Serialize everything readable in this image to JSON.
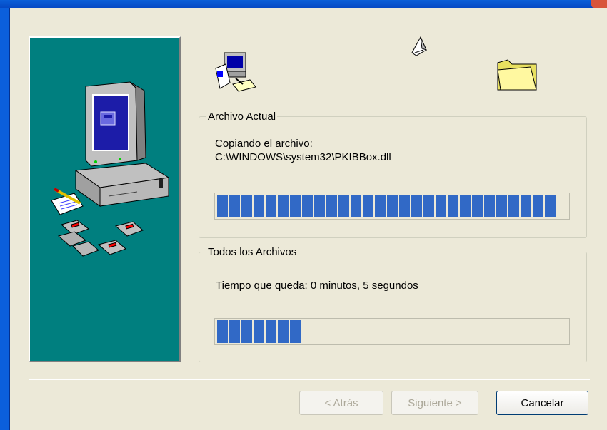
{
  "dialog": {
    "current_file_group": {
      "title": "Archivo Actual",
      "status_label": "Copiando el archivo:",
      "file_path": "C:\\WINDOWS\\system32\\PKIBBox.dll",
      "progress_fraction": 1.0
    },
    "all_files_group": {
      "title": "Todos los Archivos",
      "time_remaining": "Tiempo que queda: 0 minutos, 5 segundos",
      "progress_fraction": 0.25
    },
    "buttons": {
      "back": "< Atrás",
      "next": "Siguiente >",
      "cancel": "Cancelar"
    }
  },
  "icons": {
    "side_art": "computer-with-disks-icon",
    "setup": "setup-computer-icon",
    "flying_paper": "flying-paper-icon",
    "folder": "folder-icon"
  },
  "colors": {
    "panel_teal": "#007f7f",
    "progress_blue": "#3169c6",
    "dialog_bg": "#ece9d8",
    "titlebar_blue": "#0a5fd8"
  }
}
